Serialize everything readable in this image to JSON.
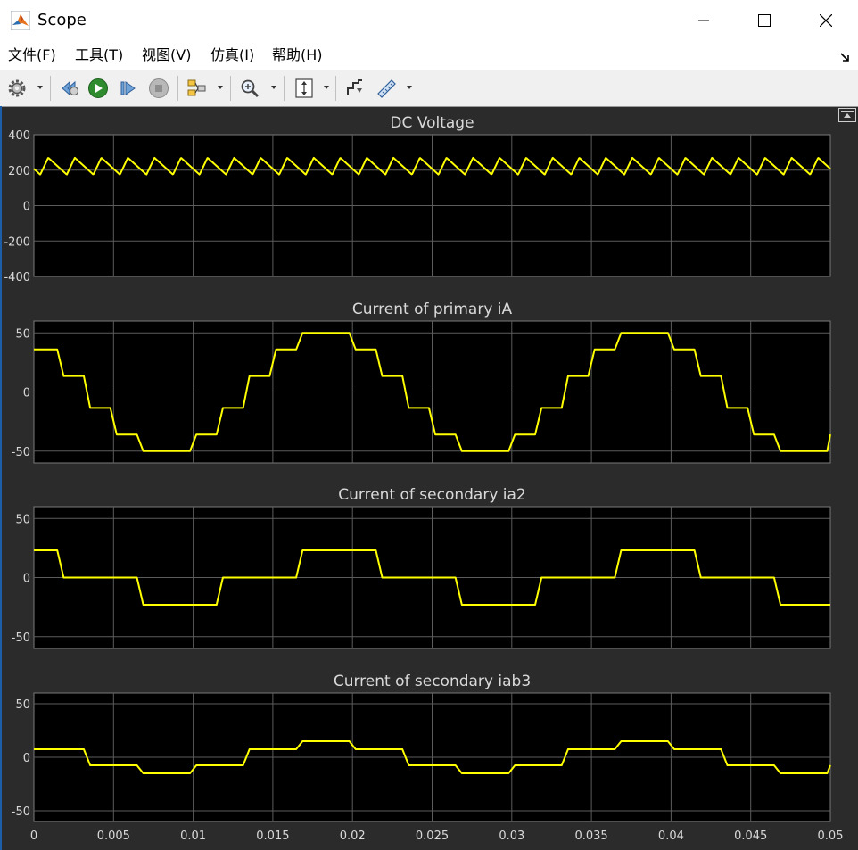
{
  "window": {
    "title": "Scope",
    "minimize_icon": "minimize-icon",
    "maximize_icon": "maximize-icon",
    "close_icon": "close-icon"
  },
  "menu": [
    {
      "label": "文件(F)"
    },
    {
      "label": "工具(T)"
    },
    {
      "label": "视图(V)"
    },
    {
      "label": "仿真(I)"
    },
    {
      "label": "帮助(H)"
    }
  ],
  "toolbar": {
    "buttons": [
      "settings-icon",
      "step-back-icon",
      "run-icon",
      "step-forward-icon",
      "stop-icon",
      "highlight-block-icon",
      "zoom-icon",
      "autoscale-icon",
      "style-icon",
      "measurement-icon"
    ]
  },
  "colors": {
    "background": "#2b2b2b",
    "axes_background": "#000000",
    "grid": "#5c5c5c",
    "trace": "#ffff00",
    "text": "#d9d9d9"
  },
  "chart_data": [
    {
      "type": "line",
      "title": "DC Voltage",
      "xlim": [
        0,
        0.05
      ],
      "ylim": [
        -400,
        400
      ],
      "yticks": [
        "400",
        "200",
        "0",
        "-200",
        "-400"
      ],
      "ytick_values": [
        400,
        200,
        0,
        -200,
        -400
      ],
      "grid": true,
      "series": [
        {
          "pattern": "ripple",
          "mean": 222,
          "peak": 270,
          "trough": 175,
          "period": 0.0016667,
          "phase": 0.0004
        }
      ]
    },
    {
      "type": "line",
      "title": "Current of primary iA",
      "xlim": [
        0,
        0.05
      ],
      "ylim": [
        -60,
        60
      ],
      "yticks": [
        "50",
        "0",
        "-50"
      ],
      "ytick_values": [
        50,
        0,
        -50
      ],
      "grid": true,
      "series": [
        {
          "pattern": "staircase",
          "levels": [
            36,
            13.5,
            -13.5,
            -36,
            -50,
            -50,
            -36,
            -13.5,
            13.5,
            36,
            50,
            50
          ],
          "step": 0.0016667,
          "start_index": 0,
          "ramp": 0.0004
        }
      ]
    },
    {
      "type": "line",
      "title": "Current of secondary ia2",
      "xlim": [
        0,
        0.05
      ],
      "ylim": [
        -60,
        60
      ],
      "yticks": [
        "50",
        "0",
        "-50"
      ],
      "ytick_values": [
        50,
        0,
        -50
      ],
      "grid": true,
      "series": [
        {
          "pattern": "staircase",
          "levels": [
            23,
            0,
            0,
            0,
            -23,
            -23,
            -23,
            0,
            0,
            0,
            23,
            23
          ],
          "step": 0.0016667,
          "start_index": 0,
          "ramp": 0.0004
        }
      ]
    },
    {
      "type": "line",
      "title": "Current of secondary iab3",
      "xlim": [
        0,
        0.05
      ],
      "ylim": [
        -60,
        60
      ],
      "yticks": [
        "50",
        "0",
        "-50"
      ],
      "ytick_values": [
        50,
        0,
        -50
      ],
      "grid": true,
      "xticks": [
        "0",
        "0.005",
        "0.01",
        "0.015",
        "0.02",
        "0.025",
        "0.03",
        "0.035",
        "0.04",
        "0.045",
        "0.05"
      ],
      "xtick_values": [
        0,
        0.005,
        0.01,
        0.015,
        0.02,
        0.025,
        0.03,
        0.035,
        0.04,
        0.045,
        0.05
      ],
      "series": [
        {
          "pattern": "staircase",
          "levels": [
            7.5,
            7.5,
            -7.5,
            -7.5,
            -15,
            -15,
            -7.5,
            -7.5,
            7.5,
            7.5,
            15,
            15
          ],
          "step": 0.0016667,
          "start_index": 0,
          "ramp": 0.0004
        }
      ]
    }
  ]
}
